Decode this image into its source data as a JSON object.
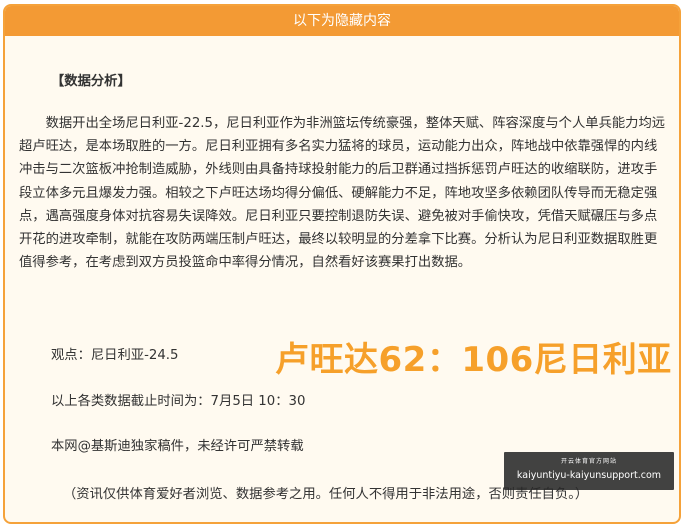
{
  "panel": {
    "header_title": "以下为隐藏内容"
  },
  "article": {
    "section_title": "【数据分析】",
    "paragraph": "数据开出全场尼日利亚-22.5，尼日利亚作为非洲篮坛传统豪强，整体天赋、阵容深度与个人单兵能力均远超卢旺达，是本场取胜的一方。尼日利亚拥有多名实力猛将的球员，运动能力出众，阵地战中依靠强悍的内线冲击与二次篮板冲抢制造威胁，外线则由具备持球投射能力的后卫群通过挡拆惩罚卢旺达的收缩联防，进攻手段立体多元且爆发力强。相较之下卢旺达场均得分偏低、硬解能力不足，阵地攻坚多依赖团队传导而无稳定强点，遇高强度身体对抗容易失误降效。尼日利亚只要控制退防失误、避免被对手偷快攻，凭借天赋碾压与多点开花的进攻牵制，就能在攻防两端压制卢旺达，最终以较明显的分差拿下比赛。分析认为尼日利亚数据取胜更值得参考，在考虑到双方员投篮命中率得分情况，自然看好该赛果打出数据。",
    "viewpoint": "观点：尼日利亚-24.5",
    "score_prediction": "卢旺达62：106尼日利亚",
    "data_cutoff": "以上各类数据截止时间为：7月5日 10：30",
    "copyright": "本网@基斯迪独家稿件，未经许可严禁转载",
    "disclaimer": "（资讯仅供体育爱好者浏览、数据参考之用。任何人不得用于非法用途，否则责任自负。）"
  },
  "watermark": {
    "top_text": "开云体育官方网站",
    "url": "kaiyuntiyu-kaiyunsupport.com"
  },
  "colors": {
    "header_bg": "#f39a34",
    "border": "#f5a23a",
    "panel_bg": "#fffaf0",
    "score_text": "#f6a02a"
  }
}
